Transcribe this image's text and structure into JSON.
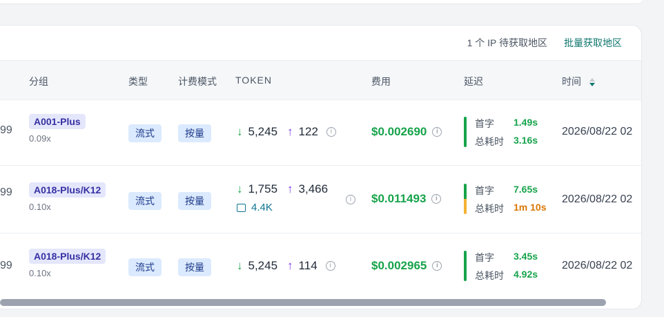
{
  "toolbar": {
    "pending_text": "1 个 IP 待获取地区",
    "batch_link": "批量获取地区"
  },
  "headers": {
    "group": "分组",
    "type": "类型",
    "billing": "计费模式",
    "token": "TOKEN",
    "cost": "费用",
    "latency": "延迟",
    "time": "时间"
  },
  "labels": {
    "first_char": "首字",
    "total_time": "总耗时"
  },
  "rows": [
    {
      "num": "99",
      "group": "A001-Plus",
      "ratio": "0.09x",
      "type": "流式",
      "billing": "按量",
      "token_in": "5,245",
      "token_out": "122",
      "cache": "",
      "cost": "$0.002690",
      "first": "1.49s",
      "total": "3.16s",
      "time": "2026/08/22 02"
    },
    {
      "num": "99",
      "group": "A018-Plus/K12",
      "ratio": "0.10x",
      "type": "流式",
      "billing": "按量",
      "token_in": "1,755",
      "token_out": "3,466",
      "cache": "4.4K",
      "cost": "$0.011493",
      "first": "7.65s",
      "total": "1m 10s",
      "time": "2026/08/22 02"
    },
    {
      "num": "99",
      "group": "A018-Plus/K12",
      "ratio": "0.10x",
      "type": "流式",
      "billing": "按量",
      "token_in": "5,245",
      "token_out": "114",
      "cache": "",
      "cost": "$0.002965",
      "first": "3.45s",
      "total": "4.92s",
      "time": "2026/08/22 02"
    }
  ],
  "colors": {
    "green": "#16a34a",
    "amber": "#d97706",
    "teal": "#0f766e"
  }
}
